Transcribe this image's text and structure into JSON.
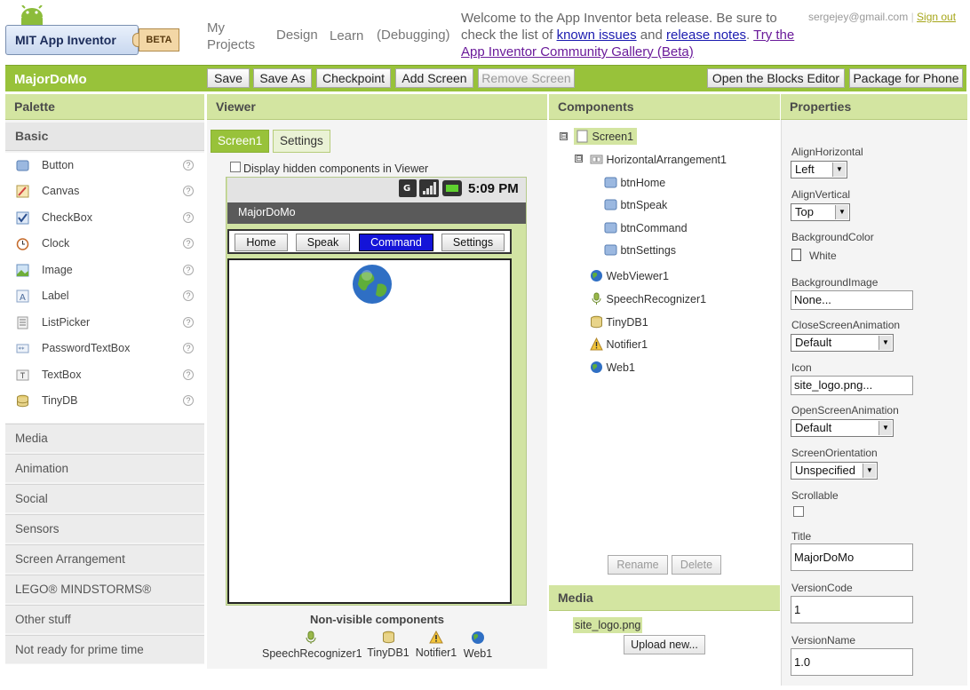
{
  "header": {
    "logo_text": "MIT App Inventor",
    "beta_label": "BETA",
    "nav": [
      "My Projects",
      "Design",
      "Learn",
      "(Debugging)"
    ],
    "welcome_text_1": "Welcome to the App Inventor beta release. Be sure to check the list of",
    "known_issues": "known issues",
    "and": "and",
    "release_notes": "release notes",
    "period": ".",
    "gallery_link": "Try the App Inventor Community Gallery (Beta)",
    "user_email": "sergejey@gmail.com",
    "separator": "|",
    "sign_out": "Sign out"
  },
  "project": {
    "name": "MajorDoMo",
    "buttons": {
      "save": "Save",
      "save_as": "Save As",
      "checkpoint": "Checkpoint",
      "add_screen": "Add Screen",
      "remove_screen": "Remove Screen",
      "open_blocks": "Open the Blocks Editor",
      "package": "Package for Phone"
    }
  },
  "palette": {
    "title": "Palette",
    "basic_title": "Basic",
    "items": [
      {
        "label": "Button",
        "icon": "button-icon"
      },
      {
        "label": "Canvas",
        "icon": "canvas-icon"
      },
      {
        "label": "CheckBox",
        "icon": "checkbox-icon"
      },
      {
        "label": "Clock",
        "icon": "clock-icon"
      },
      {
        "label": "Image",
        "icon": "image-icon"
      },
      {
        "label": "Label",
        "icon": "label-icon"
      },
      {
        "label": "ListPicker",
        "icon": "listpicker-icon"
      },
      {
        "label": "PasswordTextBox",
        "icon": "password-icon"
      },
      {
        "label": "TextBox",
        "icon": "textbox-icon"
      },
      {
        "label": "TinyDB",
        "icon": "database-icon"
      }
    ],
    "help_glyph": "?",
    "drawers": [
      "Media",
      "Animation",
      "Social",
      "Sensors",
      "Screen Arrangement",
      "LEGO® MINDSTORMS®",
      "Other stuff",
      "Not ready for prime time"
    ]
  },
  "viewer": {
    "title": "Viewer",
    "tabs": [
      "Screen1",
      "Settings"
    ],
    "display_hidden": "Display hidden components in Viewer",
    "status_time": "5:09 PM",
    "app_title": "MajorDoMo",
    "phone_buttons": [
      "Home",
      "Speak",
      "Command",
      "Settings"
    ],
    "selected_button": "Command",
    "nonvisible_title": "Non-visible components",
    "nonvisible": [
      "SpeechRecognizer1",
      "TinyDB1",
      "Notifier1",
      "Web1"
    ]
  },
  "components": {
    "title": "Components",
    "tree": {
      "screen": "Screen1",
      "harr": "HorizontalArrangement1",
      "buttons": [
        "btnHome",
        "btnSpeak",
        "btnCommand",
        "btnSettings"
      ],
      "others": [
        "WebViewer1",
        "SpeechRecognizer1",
        "TinyDB1",
        "Notifier1",
        "Web1"
      ]
    },
    "rename": "Rename",
    "delete": "Delete",
    "collapse_glyph": "⊟"
  },
  "media": {
    "title": "Media",
    "files": [
      "site_logo.png"
    ],
    "upload": "Upload new..."
  },
  "properties": {
    "title": "Properties",
    "align_horizontal_label": "AlignHorizontal",
    "align_horizontal": "Left",
    "align_vertical_label": "AlignVertical",
    "align_vertical": "Top",
    "bg_color_label": "BackgroundColor",
    "bg_color": "White",
    "bg_image_label": "BackgroundImage",
    "bg_image": "None...",
    "close_anim_label": "CloseScreenAnimation",
    "close_anim": "Default",
    "icon_label": "Icon",
    "icon": "site_logo.png...",
    "open_anim_label": "OpenScreenAnimation",
    "open_anim": "Default",
    "orientation_label": "ScreenOrientation",
    "orientation": "Unspecified",
    "scrollable_label": "Scrollable",
    "scrollable": false,
    "title_label": "Title",
    "title_value": "MajorDoMo",
    "version_code_label": "VersionCode",
    "version_code": "1",
    "version_name_label": "VersionName",
    "version_name": "1.0"
  },
  "colors": {
    "accent_green": "#98c23a",
    "panel_header": "#d3e5a1",
    "link_blue": "#1a1ab0",
    "selected_button": "#1414d8"
  }
}
